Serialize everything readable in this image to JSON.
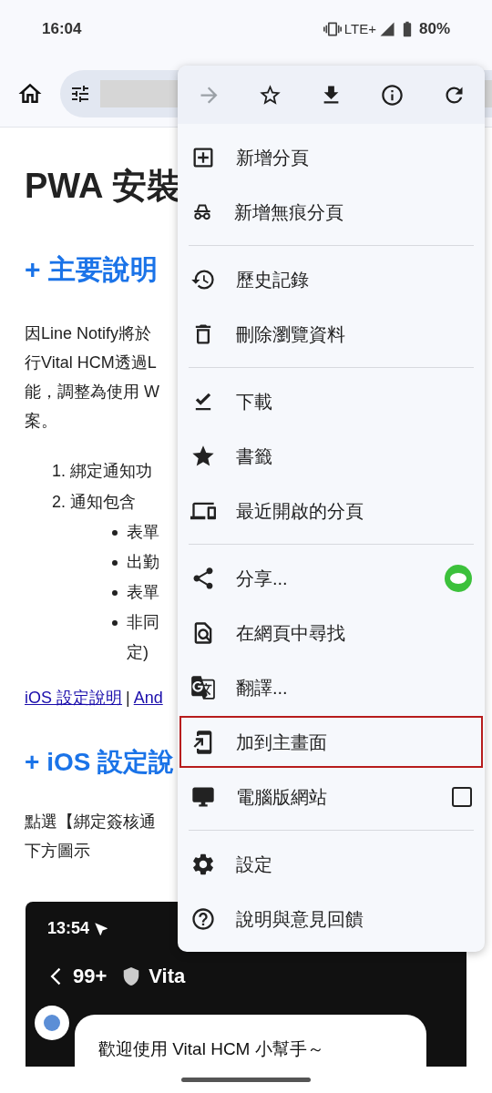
{
  "status_bar": {
    "time": "16:04",
    "network": "LTE+",
    "battery": "80%"
  },
  "page": {
    "title": "PWA 安裝",
    "heading_1": "+ 主要說明",
    "paragraph_lines": [
      "因Line Notify將於",
      "行Vital HCM透過L",
      "能，調整為使用 W",
      "案。"
    ],
    "numbered_items": [
      "1. 綁定通知功",
      "2. 通知包含"
    ],
    "bullet_items": [
      "表單",
      "出勤",
      "表單",
      "非同"
    ],
    "bullet_continuation": "定)",
    "links": [
      "iOS 設定說明",
      "And"
    ],
    "link_separator": "|",
    "heading_2": "+ iOS 設定說",
    "paragraph_2_lines": [
      "點選【綁定簽核通",
      "下方圖示"
    ],
    "screenshot": {
      "time": "13:54",
      "badge": "99+",
      "chat_title": "Vita",
      "message": "歡迎使用 Vital HCM 小幫手～"
    }
  },
  "menu": {
    "top_actions": [
      {
        "disabled": true
      },
      {
        "disabled": false
      },
      {
        "disabled": false
      },
      {
        "disabled": false
      },
      {
        "disabled": false
      }
    ],
    "groups": [
      [
        {
          "label": "新增分頁",
          "selected": false
        },
        {
          "label": "新增無痕分頁",
          "selected": false
        }
      ],
      [
        {
          "label": "歷史記錄",
          "selected": false
        },
        {
          "label": "刪除瀏覽資料",
          "selected": false
        }
      ],
      [
        {
          "label": "下載",
          "selected": false
        },
        {
          "label": "書籤",
          "selected": false
        },
        {
          "label": "最近開啟的分頁",
          "selected": false
        }
      ],
      [
        {
          "label": "分享...",
          "selected": false,
          "kind": "line-badge"
        },
        {
          "label": "在網頁中尋找",
          "selected": false
        },
        {
          "label": "翻譯...",
          "selected": false
        },
        {
          "label": "加到主畫面",
          "selected": true
        },
        {
          "label": "電腦版網站",
          "selected": false,
          "kind": "checkbox",
          "checked": false
        }
      ],
      [
        {
          "label": "設定",
          "selected": false
        },
        {
          "label": "說明與意見回饋",
          "selected": false
        }
      ]
    ]
  }
}
